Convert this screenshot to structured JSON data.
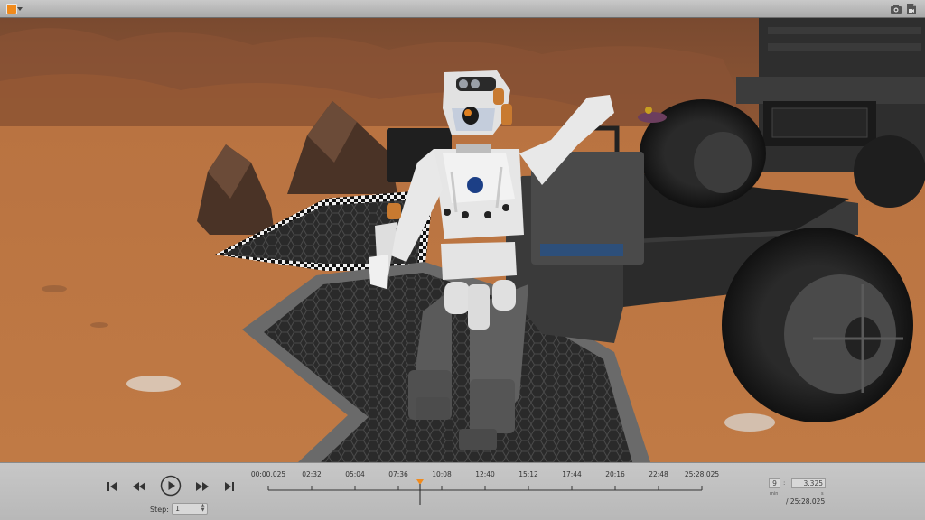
{
  "titlebar": {
    "logo_icon": "orange-square-logo-icon",
    "screenshot_icon": "camera-icon",
    "record_icon": "video-file-icon",
    "accent": "#f08a1c"
  },
  "viewport": {
    "scene": "mars-terrain-robot-rover"
  },
  "playback": {
    "skip_start_icon": "skip-to-start-icon",
    "rewind_icon": "rewind-icon",
    "play_icon": "play-icon",
    "forward_icon": "fast-forward-icon",
    "skip_end_icon": "skip-to-end-icon",
    "step_label": "Step:",
    "step_value": "1",
    "timeline_ticks": [
      "00:00.025",
      "02:32",
      "05:04",
      "07:36",
      "10:08",
      "12:40",
      "15:12",
      "17:44",
      "20:16",
      "22:48",
      "25:28.025"
    ],
    "playhead_fraction": 0.35,
    "marker_color": "#f08a1c",
    "time": {
      "minutes": "9",
      "minutes_label": "min",
      "separator": ":",
      "seconds": "3.325",
      "seconds_label": "s",
      "total": "/  25:28.025"
    }
  }
}
